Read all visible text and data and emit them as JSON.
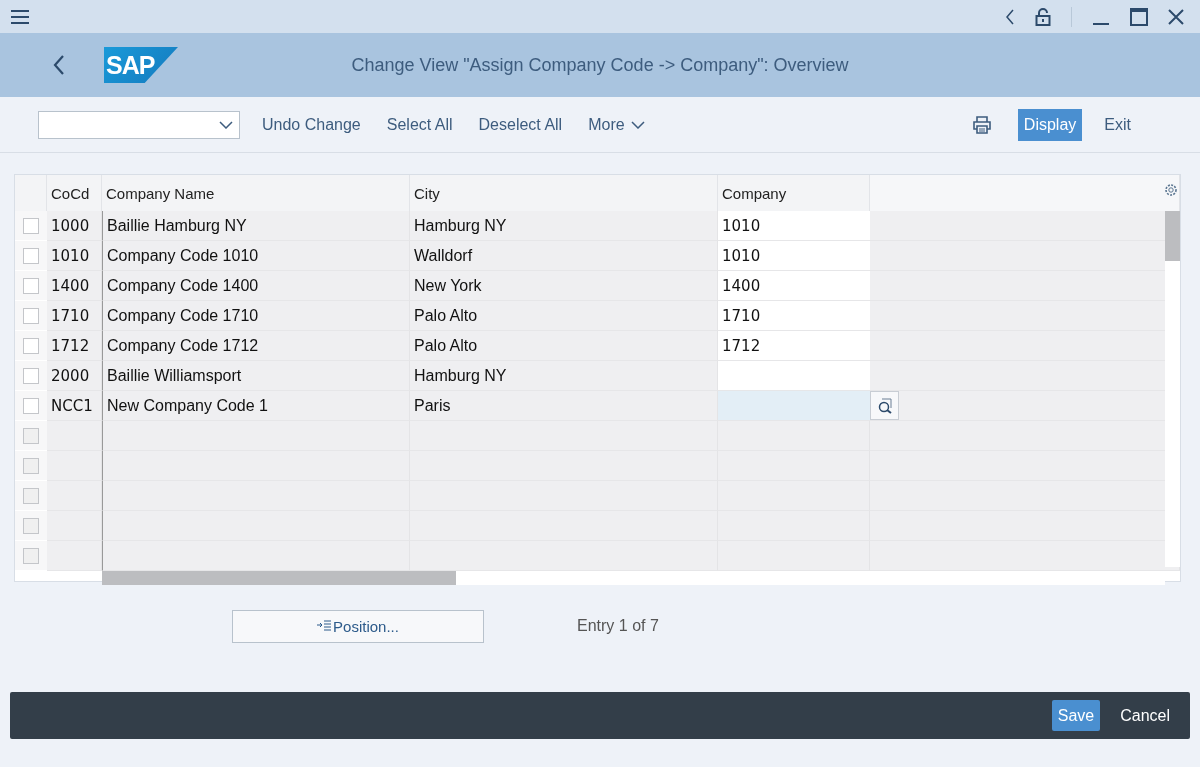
{
  "header": {
    "logo": "SAP",
    "title": "Change View \"Assign Company Code -> Company\": Overview"
  },
  "toolbar": {
    "actions": [
      "Undo Change",
      "Select All",
      "Deselect All"
    ],
    "more": "More",
    "display": {
      "label": "Display",
      "selected": true
    },
    "exit": "Exit"
  },
  "table": {
    "columns": [
      "CoCd",
      "Company Name",
      "City",
      "Company"
    ],
    "rows": [
      {
        "kind": "entry",
        "selected": false,
        "focused": false,
        "cells": [
          "1000",
          "Baillie Hamburg NY",
          "Hamburg NY",
          "1010"
        ]
      },
      {
        "kind": "entry",
        "selected": false,
        "focused": false,
        "cells": [
          "1010",
          "Company Code 1010",
          "Walldorf",
          "1010"
        ]
      },
      {
        "kind": "entry",
        "selected": false,
        "focused": false,
        "cells": [
          "1400",
          "Company Code 1400",
          "New York",
          "1400"
        ]
      },
      {
        "kind": "entry",
        "selected": false,
        "focused": false,
        "cells": [
          "1710",
          "Company Code 1710",
          "Palo Alto",
          "1710"
        ]
      },
      {
        "kind": "entry",
        "selected": false,
        "focused": false,
        "cells": [
          "1712",
          "Company Code 1712",
          "Palo Alto",
          "1712"
        ]
      },
      {
        "kind": "entry",
        "selected": false,
        "focused": false,
        "cells": [
          "2000",
          "Baillie Williamsport",
          "Hamburg NY",
          ""
        ]
      },
      {
        "kind": "entry",
        "selected": false,
        "focused": true,
        "cells": [
          "NCC1",
          "New Company Code 1",
          "Paris",
          ""
        ]
      },
      {
        "kind": "blank",
        "selected": false
      },
      {
        "kind": "blank",
        "selected": false
      },
      {
        "kind": "blank",
        "selected": false
      },
      {
        "kind": "blank",
        "selected": false
      },
      {
        "kind": "blank",
        "selected": false
      }
    ]
  },
  "position_button": "Position...",
  "entry_info": "Entry 1 of 7",
  "footer": {
    "save": "Save",
    "cancel": "Cancel"
  }
}
